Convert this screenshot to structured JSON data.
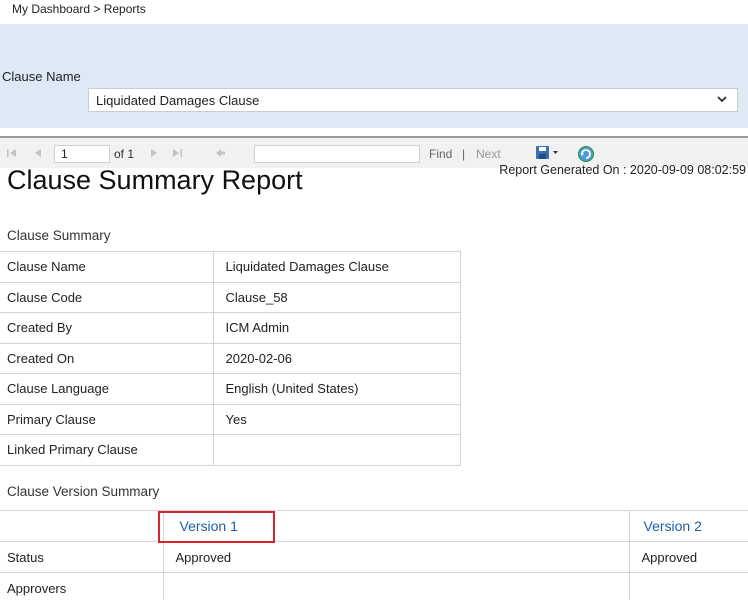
{
  "breadcrumb": "My Dashboard > Reports",
  "filter": {
    "label": "Clause Name",
    "selected": "Liquidated Damages Clause"
  },
  "toolbar": {
    "page_value": "1",
    "of_text": "of 1",
    "find_label": "Find",
    "separator": "|",
    "next_label": "Next"
  },
  "report": {
    "title": "Clause Summary Report",
    "generated": "Report Generated On : 2020-09-09 08:02:59"
  },
  "clause_summary": {
    "heading": "Clause Summary",
    "rows": [
      {
        "label": "Clause Name",
        "value": "Liquidated Damages Clause"
      },
      {
        "label": "Clause Code",
        "value": "Clause_58"
      },
      {
        "label": "Created By",
        "value": "ICM Admin"
      },
      {
        "label": "Created On",
        "value": "2020-02-06"
      },
      {
        "label": "Clause Language",
        "value": "English (United States)"
      },
      {
        "label": "Primary Clause",
        "value": "Yes"
      },
      {
        "label": "Linked Primary Clause",
        "value": ""
      }
    ]
  },
  "version_summary": {
    "heading": "Clause Version Summary",
    "versions": [
      "Version 1",
      "Version 2"
    ],
    "rows": [
      {
        "label": "Status",
        "values": [
          "Approved",
          "Approved"
        ]
      },
      {
        "label": "Approvers",
        "values": [
          "",
          ""
        ]
      }
    ]
  },
  "colors": {
    "panel_bg": "#dde9f4",
    "link_blue": "#1f5fa6",
    "highlight_red": "#d9232e"
  }
}
